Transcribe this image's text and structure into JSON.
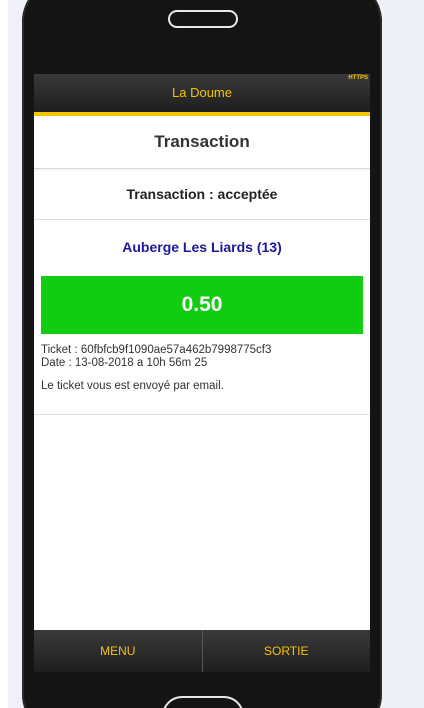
{
  "header": {
    "title": "La Doume",
    "https_badge": "HTTPS"
  },
  "page": {
    "title": "Transaction"
  },
  "transaction": {
    "status_text": "Transaction : acceptée",
    "merchant": "Auberge Les Liards (13)",
    "amount": "0.50",
    "ticket_line": "Ticket : 60fbfcb9f1090ae57a462b7998775cf3",
    "date_line": "Date : 13-08-2018 a 10h 56m 25",
    "email_notice": "Le ticket vous est envoyé par email."
  },
  "footer": {
    "menu_label": "MENU",
    "exit_label": "SORTIE"
  },
  "colors": {
    "accent": "#f5c400",
    "amount_bg": "#11cc11",
    "merchant_text": "#1a1aa0",
    "bar_dark": "#1e1e1e"
  }
}
